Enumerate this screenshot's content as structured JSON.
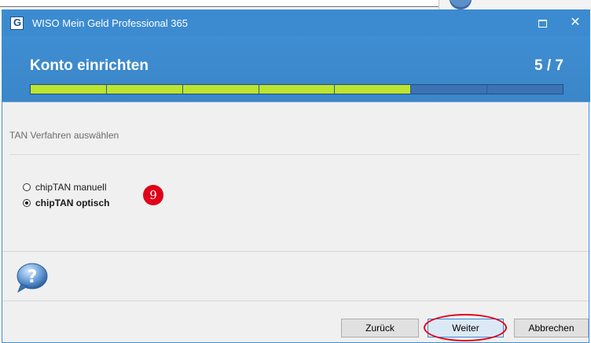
{
  "window": {
    "title": "WISO Mein Geld Professional 365",
    "close_glyph": "✕"
  },
  "wizard": {
    "title": "Konto einrichten",
    "step_counter": "5 / 7",
    "progress": {
      "completed_steps": 5,
      "total_steps": 7
    }
  },
  "section": {
    "label": "TAN Verfahren auswählen"
  },
  "tan_methods": [
    {
      "label": "chipTAN manuell",
      "selected": false
    },
    {
      "label": "chipTAN optisch",
      "selected": true
    }
  ],
  "annotation": {
    "step_number": "9",
    "color": "#e0001a"
  },
  "buttons": {
    "back": "Zurück",
    "next": "Weiter",
    "cancel": "Abbrechen"
  },
  "colors": {
    "titlebar": "#3c8bd0",
    "progress_done": "#bde42f",
    "progress_todo": "#3c73b4"
  },
  "icons": {
    "help": "help-question-bubble-icon",
    "app": "wiso-app-icon"
  }
}
